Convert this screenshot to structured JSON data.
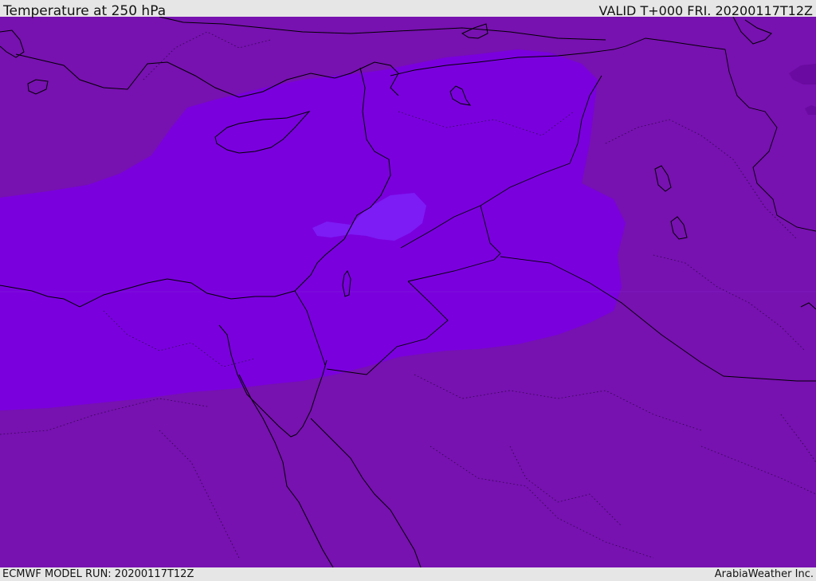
{
  "header": {
    "title": "Temperature at 250 hPa",
    "valid_time": "VALID T+000 FRI. 20200117T12Z"
  },
  "footer": {
    "model_run": "ECMWF MODEL RUN: 20200117T12Z",
    "credit": "ArabiaWeather Inc."
  },
  "map": {
    "variable": "temperature",
    "pressure_level_hpa": 250,
    "colors": {
      "warm_band": "#7711b0",
      "cold_band": "#7a00de",
      "coldest_core": "#7d1cf5",
      "warm_pocket": "#6a0aa0",
      "coastline": "#000000",
      "border_international": "#000000",
      "border_admin": "#2a0a40"
    }
  }
}
